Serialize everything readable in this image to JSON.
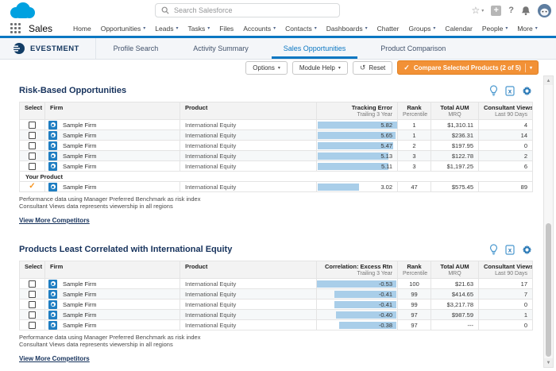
{
  "colors": {
    "salesforce_blue": "#00a1e0",
    "accent_blue": "#0b77c2",
    "brand_navy": "#16325c",
    "bar_blue": "#a9cee9",
    "compare_orange": "#f29136",
    "check_orange": "#f7941e"
  },
  "header": {
    "search_placeholder": "Search Salesforce",
    "app_name": "Sales",
    "nav_items": [
      {
        "label": "Home",
        "caret": false
      },
      {
        "label": "Opportunities",
        "caret": true
      },
      {
        "label": "Leads",
        "caret": true
      },
      {
        "label": "Tasks",
        "caret": true
      },
      {
        "label": "Files",
        "caret": false
      },
      {
        "label": "Accounts",
        "caret": true
      },
      {
        "label": "Contacts",
        "caret": true
      },
      {
        "label": "Dashboards",
        "caret": true
      },
      {
        "label": "Chatter",
        "caret": false
      },
      {
        "label": "Groups",
        "caret": true
      },
      {
        "label": "Calendar",
        "caret": false
      },
      {
        "label": "People",
        "caret": true
      },
      {
        "label": "More",
        "caret": true
      }
    ]
  },
  "tabbar": {
    "brand": "EVESTMENT",
    "tabs": [
      {
        "label": "Profile Search",
        "active": false
      },
      {
        "label": "Activity Summary",
        "active": false
      },
      {
        "label": "Sales Opportunities",
        "active": true
      },
      {
        "label": "Product Comparison",
        "active": false
      }
    ]
  },
  "toolbar": {
    "options_label": "Options",
    "module_help_label": "Module Help",
    "reset_label": "Reset",
    "compare_label": "Compare Selected Products (2 of 5)"
  },
  "sections": [
    {
      "title": "Risk-Based Opportunities",
      "bar_align": "left",
      "columns": [
        {
          "key": "select",
          "label": "Select",
          "sub": ""
        },
        {
          "key": "firm",
          "label": "Firm",
          "sub": ""
        },
        {
          "key": "product",
          "label": "Product",
          "sub": ""
        },
        {
          "key": "metric",
          "label": "Tracking Error",
          "sub": "Trailing 3 Year"
        },
        {
          "key": "rank",
          "label": "Rank",
          "sub": "Percentile"
        },
        {
          "key": "aum",
          "label": "Total AUM",
          "sub": "MRQ"
        },
        {
          "key": "views",
          "label": "Consultant Views",
          "sub": "Last 90 Days"
        }
      ],
      "rows": [
        {
          "firm": "Sample Firm",
          "product": "International Equity",
          "metric": "5.82",
          "metric_val": 5.82,
          "rank": "1",
          "aum": "$1,310.11",
          "views": "4"
        },
        {
          "firm": "Sample Firm",
          "product": "International Equity",
          "metric": "5.65",
          "metric_val": 5.65,
          "rank": "1",
          "aum": "$236.31",
          "views": "14"
        },
        {
          "firm": "Sample Firm",
          "product": "International Equity",
          "metric": "5.47",
          "metric_val": 5.47,
          "rank": "2",
          "aum": "$197.95",
          "views": "0"
        },
        {
          "firm": "Sample Firm",
          "product": "International Equity",
          "metric": "5.13",
          "metric_val": 5.13,
          "rank": "3",
          "aum": "$122.78",
          "views": "2"
        },
        {
          "firm": "Sample Firm",
          "product": "International Equity",
          "metric": "5.11",
          "metric_val": 5.11,
          "rank": "3",
          "aum": "$1,197.25",
          "views": "6"
        }
      ],
      "separator_label": "Your Product",
      "your_row": {
        "firm": "Sample Firm",
        "product": "International Equity",
        "metric": "3.02",
        "metric_val": 3.02,
        "rank": "47",
        "aum": "$575.45",
        "views": "89"
      },
      "footnote1": "Performance data using Manager Preferred Benchmark as risk index",
      "footnote2": "Consultant Views data represents viewership in all regions",
      "link_label": "View More Competitors"
    },
    {
      "title": "Products Least Correlated with International Equity",
      "bar_align": "right",
      "columns": [
        {
          "key": "select",
          "label": "Select",
          "sub": ""
        },
        {
          "key": "firm",
          "label": "Firm",
          "sub": ""
        },
        {
          "key": "product",
          "label": "Product",
          "sub": ""
        },
        {
          "key": "metric",
          "label": "Correlation: Excess Rtn",
          "sub": "Trailing 3 Year"
        },
        {
          "key": "rank",
          "label": "Rank",
          "sub": "Percentile"
        },
        {
          "key": "aum",
          "label": "Total AUM",
          "sub": "MRQ"
        },
        {
          "key": "views",
          "label": "Consultant Views",
          "sub": "Last 90 Days"
        }
      ],
      "rows": [
        {
          "firm": "Sample Firm",
          "product": "International Equity",
          "metric": "-0.53",
          "metric_val": -0.53,
          "rank": "100",
          "aum": "$21.63",
          "views": "17"
        },
        {
          "firm": "Sample Firm",
          "product": "International Equity",
          "metric": "-0.41",
          "metric_val": -0.41,
          "rank": "99",
          "aum": "$414.65",
          "views": "7"
        },
        {
          "firm": "Sample Firm",
          "product": "International Equity",
          "metric": "-0.41",
          "metric_val": -0.41,
          "rank": "99",
          "aum": "$3,217.78",
          "views": "0"
        },
        {
          "firm": "Sample Firm",
          "product": "International Equity",
          "metric": "-0.40",
          "metric_val": -0.4,
          "rank": "97",
          "aum": "$987.59",
          "views": "1"
        },
        {
          "firm": "Sample Firm",
          "product": "International Equity",
          "metric": "-0.38",
          "metric_val": -0.38,
          "rank": "97",
          "aum": "---",
          "views": "0"
        }
      ],
      "footnote1": "Performance data using Manager Preferred Benchmark as risk index",
      "footnote2": "Consultant Views data represents viewership in all regions",
      "link_label": "View More Competitors"
    }
  ]
}
